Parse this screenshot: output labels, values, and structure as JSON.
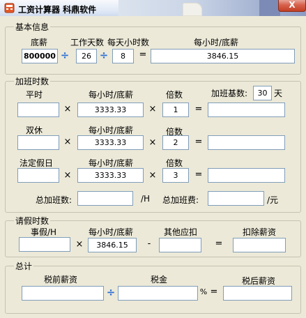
{
  "window": {
    "title": "工资计算器 科鼎软件",
    "close_label": "X"
  },
  "basic": {
    "legend": "基本信息",
    "salary_label": "底薪",
    "days_label": "工作天数",
    "hours_label": "每天小时数",
    "rate_label": "每小时/底薪",
    "salary_value": "800000",
    "days_value": "26",
    "hours_value": "8",
    "rate_value": "3846.15",
    "op_div": "÷",
    "op_eq": "="
  },
  "overtime": {
    "legend": "加班时数",
    "hour_rate_label": "每小时/底薪",
    "multiplier_label": "倍数",
    "base_label": "加班基数:",
    "base_value": "30",
    "base_unit": "天",
    "op_mul": "×",
    "op_eq": "=",
    "rows": [
      {
        "label": "平时",
        "rate": "3333.33",
        "multiplier": "1"
      },
      {
        "label": "双休",
        "rate": "3333.33",
        "multiplier": "2"
      },
      {
        "label": "法定假日",
        "rate": "3333.33",
        "multiplier": "3"
      }
    ],
    "total_hours_label": "总加班数:",
    "total_hours_unit": "/H",
    "total_pay_label": "总加班费:",
    "total_pay_unit": "/元"
  },
  "leave": {
    "legend": "请假时数",
    "hours_label": "事假/H",
    "rate_label": "每小时/底薪",
    "other_label": "其他应扣",
    "deduct_label": "扣除薪资",
    "rate_value": "3846.15",
    "op_mul": "×",
    "op_minus": "-",
    "op_eq": "="
  },
  "total": {
    "legend": "总计",
    "pretax_label": "税前薪资",
    "tax_label": "税金",
    "aftertax_label": "税后薪资",
    "op_div": "÷",
    "op_pct": "%",
    "op_eq": "="
  },
  "colors": {
    "background": "#ece9d8",
    "input_border": "#7f9db9",
    "operator_blue": "#2b6fd6",
    "close_button": "#c94a30"
  }
}
